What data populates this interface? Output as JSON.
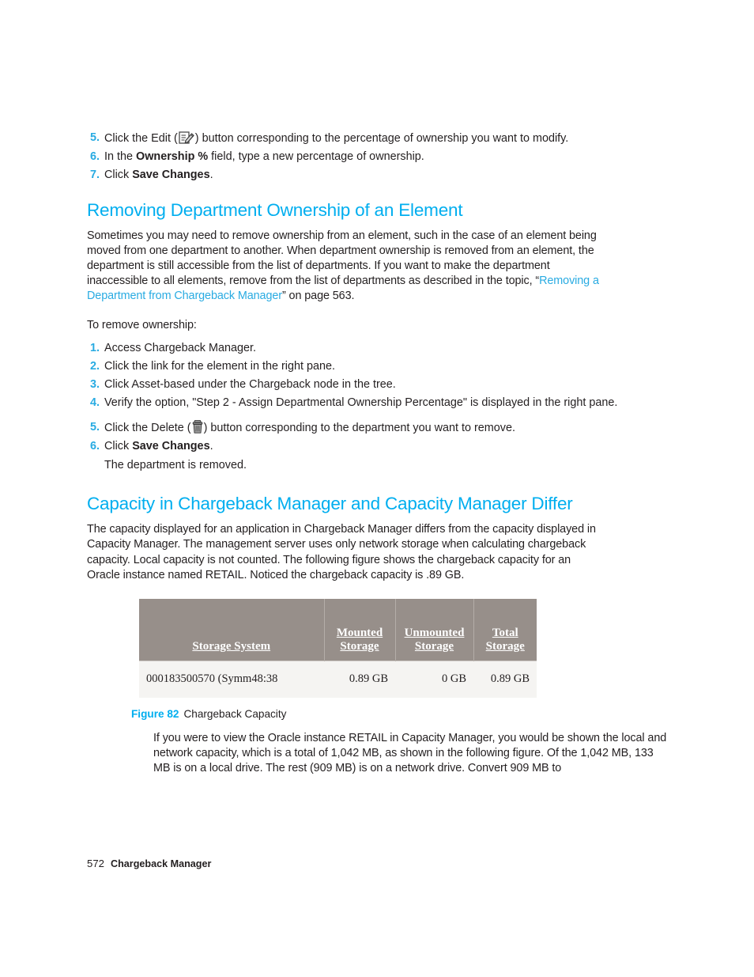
{
  "document": {
    "footer": {
      "page_number": "572",
      "chapter_title": "Chargeback Manager"
    }
  },
  "top_steps": [
    {
      "number": "5.",
      "text_before": "Click the Edit (",
      "icon": "edit-icon",
      "text_after": ") button corresponding to the percentage of ownership you want to modify."
    },
    {
      "number": "6.",
      "prefix": "In the ",
      "bold": "Ownership %",
      "suffix": " field, type a new percentage of ownership."
    },
    {
      "number": "7.",
      "prefix": "Click ",
      "bold": "Save Changes",
      "suffix": "."
    }
  ],
  "section_removing": {
    "heading": "Removing Department Ownership of an Element",
    "paragraph_part1": "Sometimes you may need to remove ownership from an element, such in the case of an element being moved from one department to another. When department ownership is removed from an element, the department is still accessible from the list of departments. If you want to make the department inaccessible to all elements, remove from the list of departments as described in the topic, “",
    "link_text": "Removing a Department from Chargeback Manager",
    "paragraph_part2": "” on page 563.",
    "intro": "To remove ownership:",
    "steps": [
      {
        "number": "1.",
        "text": "Access Chargeback Manager."
      },
      {
        "number": "2.",
        "text": "Click the link for the element in the right pane."
      },
      {
        "number": "3.",
        "text": "Click Asset-based under the Chargeback node in the tree."
      },
      {
        "number": "4.",
        "text": "Verify the option, \"Step 2 - Assign Departmental Ownership Percentage\" is displayed in the right pane."
      }
    ],
    "steps_cont": [
      {
        "number": "5.",
        "text_before": "Click the Delete (",
        "icon": "delete-icon",
        "text_after": ") button corresponding to the department you want to remove."
      },
      {
        "number": "6.",
        "prefix": "Click ",
        "bold": "Save Changes",
        "suffix": ".",
        "sub_text": "The department is removed."
      }
    ]
  },
  "section_capacity": {
    "heading": "Capacity in Chargeback Manager and Capacity Manager Differ",
    "paragraph": "The capacity displayed for an application in Chargeback Manager differs from the capacity displayed in Capacity Manager. The management server uses only network storage when calculating chargeback capacity. Local capacity is not counted. The following figure shows the chargeback capacity for an Oracle instance named RETAIL. Noticed the chargeback capacity is .89 GB.",
    "paragraph_after_figure": "If you were to view the Oracle instance RETAIL in Capacity Manager, you would be shown the local and network capacity, which is a total of 1,042 MB, as shown in the following figure. Of the 1,042 MB, 133 MB is on a local drive. The rest (909 MB) is on a network drive. Convert 909 MB to"
  },
  "figure": {
    "label": "Figure 82",
    "title": "Chargeback Capacity",
    "table": {
      "headers": [
        {
          "line1": "",
          "line2": "Storage System"
        },
        {
          "line1": "Mounted",
          "line2": "Storage"
        },
        {
          "line1": "Unmounted",
          "line2": "Storage"
        },
        {
          "line1": "Total",
          "line2": "Storage"
        }
      ],
      "rows": [
        {
          "storage_system": "000183500570 (Symm48:38",
          "mounted_storage": "0.89 GB",
          "unmounted_storage": "0 GB",
          "total_storage": "0.89 GB"
        }
      ]
    }
  },
  "colors": {
    "heading_blue": "#00aeef",
    "link_blue": "#29abe2",
    "table_header_gray": "#978f8a",
    "table_row_bg": "#f5f4f2",
    "body_text": "#231f20"
  }
}
